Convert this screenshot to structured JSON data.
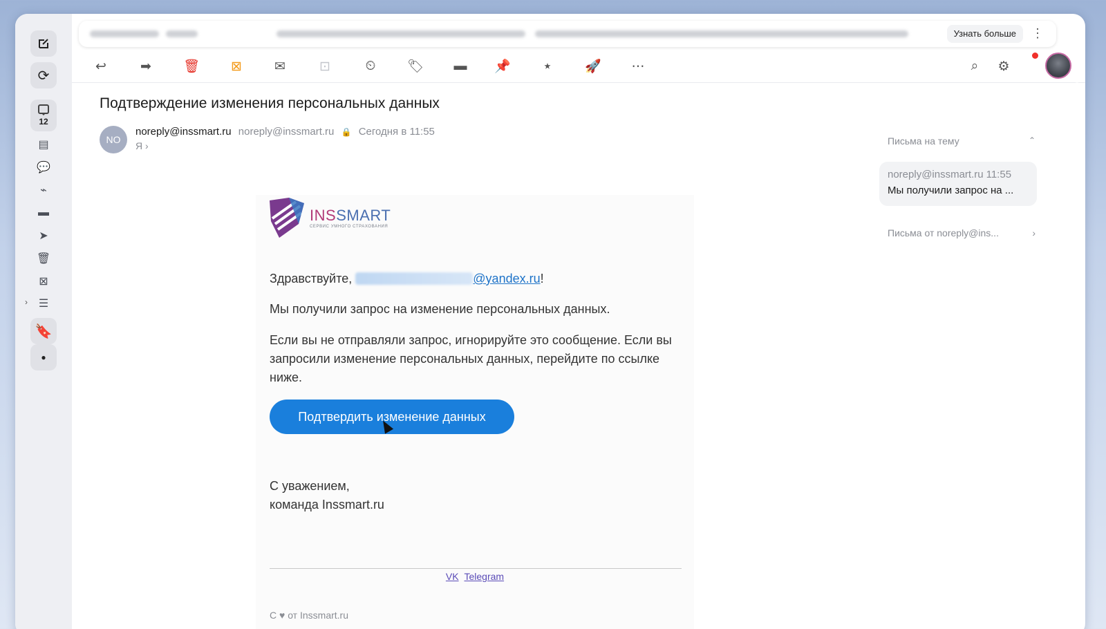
{
  "ad": {
    "cta_label": "Узнать больше",
    "menu_icon": "more-vertical-icon"
  },
  "sidebar": {
    "inbox_count": "12",
    "icons": [
      "compose-icon",
      "refresh-icon",
      "inbox-icon",
      "archive-icon",
      "chat-icon",
      "attachment-icon",
      "folder-icon",
      "sent-icon",
      "trash-icon",
      "spam-icon",
      "newsletters-icon",
      "bookmark-icon",
      "dot-icon"
    ]
  },
  "toolbar": {
    "icons": [
      "reply-icon",
      "forward-icon",
      "delete-icon",
      "spam-icon",
      "mark-unread-icon",
      "archive-icon",
      "remind-icon",
      "label-icon",
      "move-to-folder-icon",
      "pin-icon",
      "create-folder-icon",
      "filter-icon",
      "more-icon"
    ],
    "search_icon": "search-icon",
    "settings_icon": "settings-icon"
  },
  "email": {
    "subject": "Подтверждение изменения персональных данных",
    "sender_initials": "NO",
    "sender_name": "noreply@inssmart.ru",
    "sender_address": "noreply@inssmart.ru",
    "date": "Сегодня в 11:55",
    "recipient": "Я",
    "logo_name_prefix": "INS",
    "logo_name_suffix": "SMART",
    "logo_tagline": "СЕРВИС УМНОГО СТРАХОВАНИЯ",
    "greeting_prefix": "Здравствуйте, ",
    "greeting_domain": "@yandex.ru",
    "greeting_suffix": "!",
    "paragraph1": "Мы получили запрос на изменение персональных данных.",
    "paragraph2": "Если вы не отправляли запрос, игнорируйте это сообщение. Если вы запросили изменение персональных данных, перейдите по ссылке ниже.",
    "confirm_button": "Подтвердить изменение данных",
    "signoff_line1": "С уважением,",
    "signoff_line2": "команда Inssmart.ru",
    "social_vk": "VK",
    "social_telegram": "Telegram",
    "footer": "С ♥ от Inssmart.ru"
  },
  "thread": {
    "header": "Письма на тему",
    "card_sender": "noreply@inssmart.ru",
    "card_time": "11:55",
    "card_preview": "Мы получили запрос на ...",
    "from_link": "Письма от noreply@ins..."
  },
  "colors": {
    "accent": "#1a7fdc",
    "link": "#1e73c8",
    "brand_pink": "#b23a78",
    "brand_blue": "#4a6fb0",
    "notification": "#f0302a"
  }
}
